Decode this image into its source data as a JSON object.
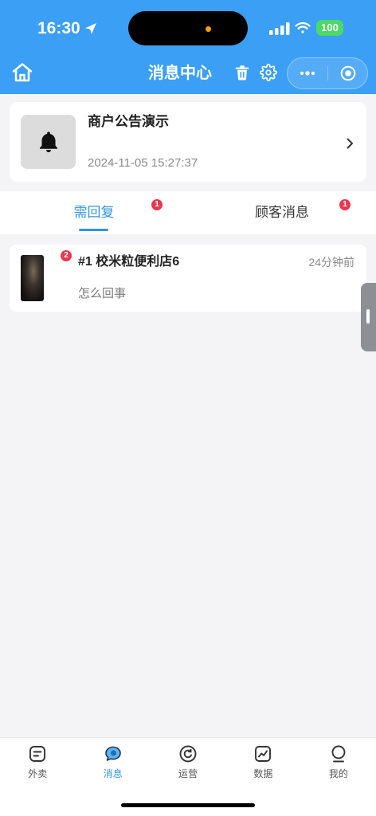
{
  "status_bar": {
    "time": "16:30",
    "battery": "100"
  },
  "header": {
    "title": "消息中心"
  },
  "announcement": {
    "title": "商户公告演示",
    "date": "2024-11-05 15:27:37",
    "icon": "bell-icon"
  },
  "tabs": [
    {
      "label": "需回复",
      "badge": "1",
      "selected": true
    },
    {
      "label": "顾客消息",
      "badge": "1",
      "selected": false
    }
  ],
  "messages": [
    {
      "badge": "2",
      "title": "#1 校米粒便利店6",
      "time": "24分钟前",
      "preview": "怎么回事"
    }
  ],
  "bottom_nav": [
    {
      "label": "外卖",
      "icon": "takeout-icon",
      "selected": false
    },
    {
      "label": "消息",
      "icon": "message-icon",
      "selected": true
    },
    {
      "label": "运营",
      "icon": "operations-icon",
      "selected": false
    },
    {
      "label": "数据",
      "icon": "chart-icon",
      "selected": false
    },
    {
      "label": "我的",
      "icon": "profile-icon",
      "selected": false
    }
  ],
  "colors": {
    "header_blue": "#3a9ff5",
    "accent": "#2f94e6",
    "badge_red": "#e8384f",
    "battery_green": "#4cd964"
  }
}
